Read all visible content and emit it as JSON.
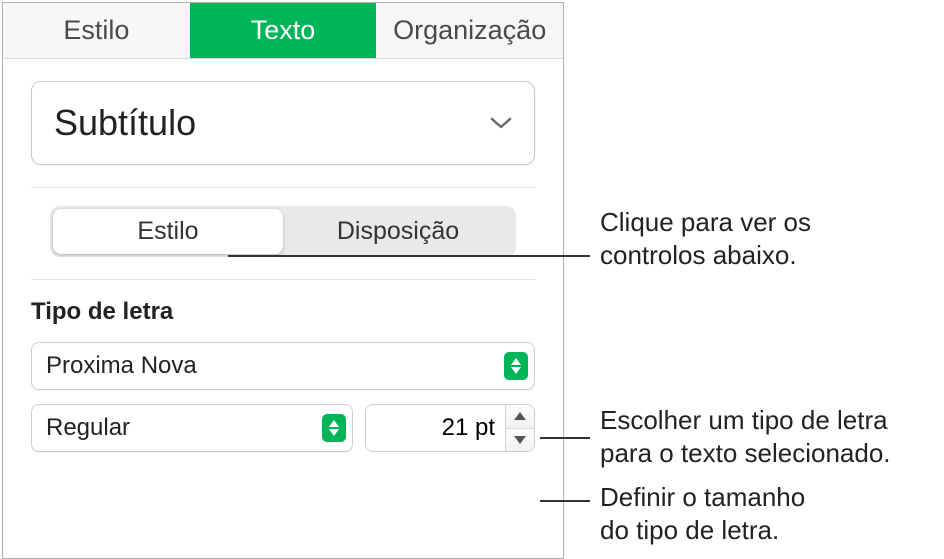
{
  "tabs": {
    "style": "Estilo",
    "text": "Texto",
    "arrange": "Organização"
  },
  "paragraphStyle": {
    "selected": "Subtítulo"
  },
  "sub_tabs": {
    "style": "Estilo",
    "layout": "Disposição"
  },
  "font": {
    "section_label": "Tipo de letra",
    "family": "Proxima Nova",
    "style": "Regular",
    "size": "21 pt"
  },
  "callouts": {
    "sub_tab": "Clique para ver os\ncontrolos abaixo.",
    "font_family": "Escolher um tipo de letra\npara o texto selecionado.",
    "font_size": "Definir o tamanho\ndo tipo de letra."
  }
}
